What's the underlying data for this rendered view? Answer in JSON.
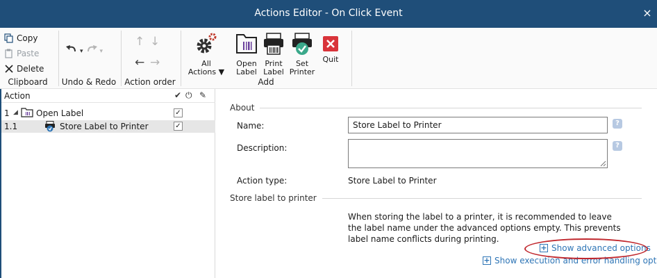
{
  "window": {
    "title": "Actions Editor - On Click Event",
    "close_glyph": "×"
  },
  "ribbon": {
    "clipboard": {
      "copy": "Copy",
      "paste": "Paste",
      "delete": "Delete",
      "group_label": "Clipboard"
    },
    "undo_redo": {
      "group_label": "Undo & Redo"
    },
    "action_order": {
      "group_label": "Action order"
    },
    "add": {
      "all_actions_line1": "All",
      "all_actions_line2": "Actions",
      "open_label_1": "Open",
      "open_label_2": "Label",
      "print_label_1": "Print",
      "print_label_2": "Label",
      "set_printer_1": "Set",
      "set_printer_2": "Printer",
      "quit": "Quit",
      "group_label": "Add"
    }
  },
  "tree": {
    "header": {
      "action": "Action"
    },
    "rows": [
      {
        "number": "1",
        "label": "Open Label",
        "checked": "✓"
      },
      {
        "number": "1.1",
        "label": "Store Label to Printer",
        "checked": "✓"
      }
    ]
  },
  "panel": {
    "about_section": "About",
    "name_label": "Name:",
    "name_value": "Store Label to Printer",
    "description_label": "Description:",
    "description_value": "",
    "action_type_label": "Action type:",
    "action_type_value": "Store Label to Printer",
    "store_section": "Store label to printer",
    "note": "When storing the label to a printer, it is recommended to leave the label name under the advanced options empty. This prevents label name conflicts during printing.",
    "show_advanced": "Show advanced options",
    "show_execution": "Show execution and error handling options",
    "help_glyph": "?"
  },
  "colors": {
    "titlebar": "#1f4e79",
    "link": "#2e75b6",
    "highlight_oval": "#c0282e",
    "quit_red": "#d9343a",
    "gear_green": "#3a7d44"
  }
}
